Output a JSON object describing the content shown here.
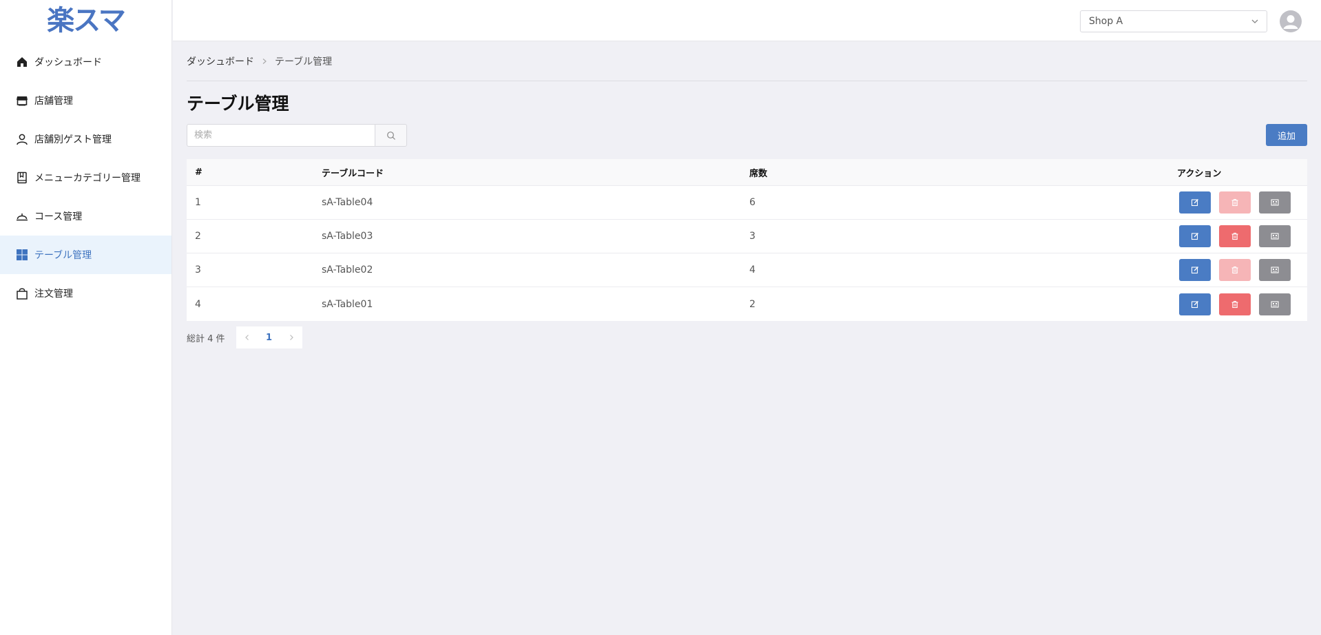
{
  "app": {
    "logo_text": "楽スマ"
  },
  "sidebar": {
    "items": [
      {
        "label": "ダッシュボード",
        "icon": "home-icon"
      },
      {
        "label": "店舗管理",
        "icon": "store-icon"
      },
      {
        "label": "店舗別ゲスト管理",
        "icon": "user-icon"
      },
      {
        "label": "メニューカテゴリー管理",
        "icon": "book-icon"
      },
      {
        "label": "コース管理",
        "icon": "cloche-icon"
      },
      {
        "label": "テーブル管理",
        "icon": "grid-icon",
        "active": true
      },
      {
        "label": "注文管理",
        "icon": "bag-icon"
      }
    ]
  },
  "header": {
    "shop_selected": "Shop A"
  },
  "breadcrumb": {
    "home": "ダッシュボード",
    "current": "テーブル管理"
  },
  "page": {
    "title": "テーブル管理"
  },
  "search": {
    "placeholder": "検索"
  },
  "toolbar": {
    "add_label": "追加"
  },
  "table": {
    "columns": {
      "num": "#",
      "code": "テーブルコード",
      "seats": "席数",
      "actions": "アクション"
    },
    "rows": [
      {
        "num": "1",
        "code": "sA-Table04",
        "seats": "6",
        "delete_enabled": false
      },
      {
        "num": "2",
        "code": "sA-Table03",
        "seats": "3",
        "delete_enabled": true
      },
      {
        "num": "3",
        "code": "sA-Table02",
        "seats": "4",
        "delete_enabled": false
      },
      {
        "num": "4",
        "code": "sA-Table01",
        "seats": "2",
        "delete_enabled": true
      }
    ]
  },
  "pagination": {
    "total": "総計 4 件",
    "current_page": "1"
  },
  "colors": {
    "accent": "#4a7cc4",
    "danger": "#ee6b6e",
    "secondary": "#8d8d92"
  }
}
